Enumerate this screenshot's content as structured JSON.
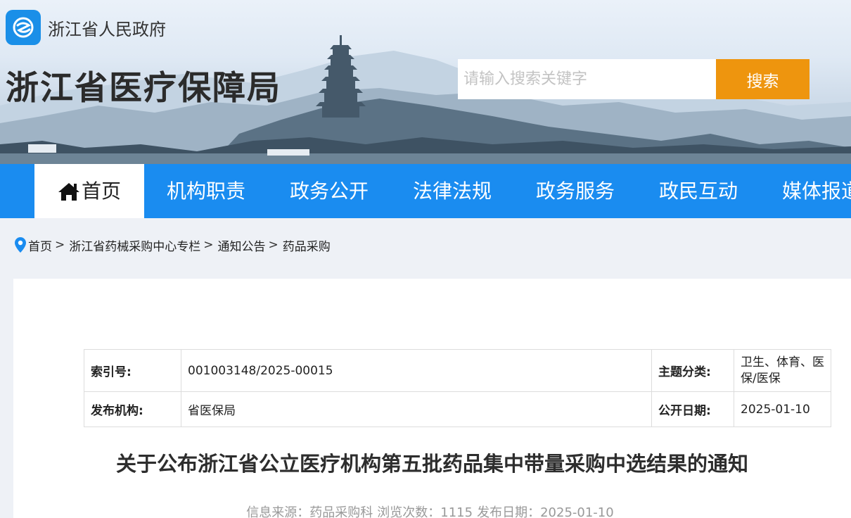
{
  "header": {
    "gov_name": "浙江省人民政府",
    "site_title": "浙江省医疗保障局",
    "search_placeholder": "请输入搜索关键字",
    "search_button": "搜索"
  },
  "nav": {
    "items": [
      {
        "label": "首页",
        "icon": "home-icon",
        "active": true
      },
      {
        "label": "机构职责"
      },
      {
        "label": "政务公开"
      },
      {
        "label": "法律法规"
      },
      {
        "label": "政务服务"
      },
      {
        "label": "政民互动"
      },
      {
        "label": "媒体报道"
      }
    ]
  },
  "breadcrumb": {
    "icon": "location-pin-icon",
    "items": [
      "首页",
      "浙江省药械采购中心专栏",
      "通知公告",
      "药品采购"
    ],
    "separator": ">"
  },
  "meta": {
    "index_label": "索引号:",
    "index_value": "001003148/2025-00015",
    "topic_label": "主题分类:",
    "topic_value": "卫生、体育、医保/医保",
    "publisher_label": "发布机构:",
    "publisher_value": "省医保局",
    "open_date_label": "公开日期:",
    "open_date_value": "2025-01-10"
  },
  "article": {
    "title": "关于公布浙江省公立医疗机构第五批药品集中带量采购中选结果的通知",
    "source": "信息来源：药品采购科",
    "views": "浏览次数：1115",
    "publish_date": "发布日期：2025-01-10"
  },
  "colors": {
    "nav_bg": "#1a8cf0",
    "search_button": "#ee950e",
    "logo_bg": "#1a8fe8"
  }
}
